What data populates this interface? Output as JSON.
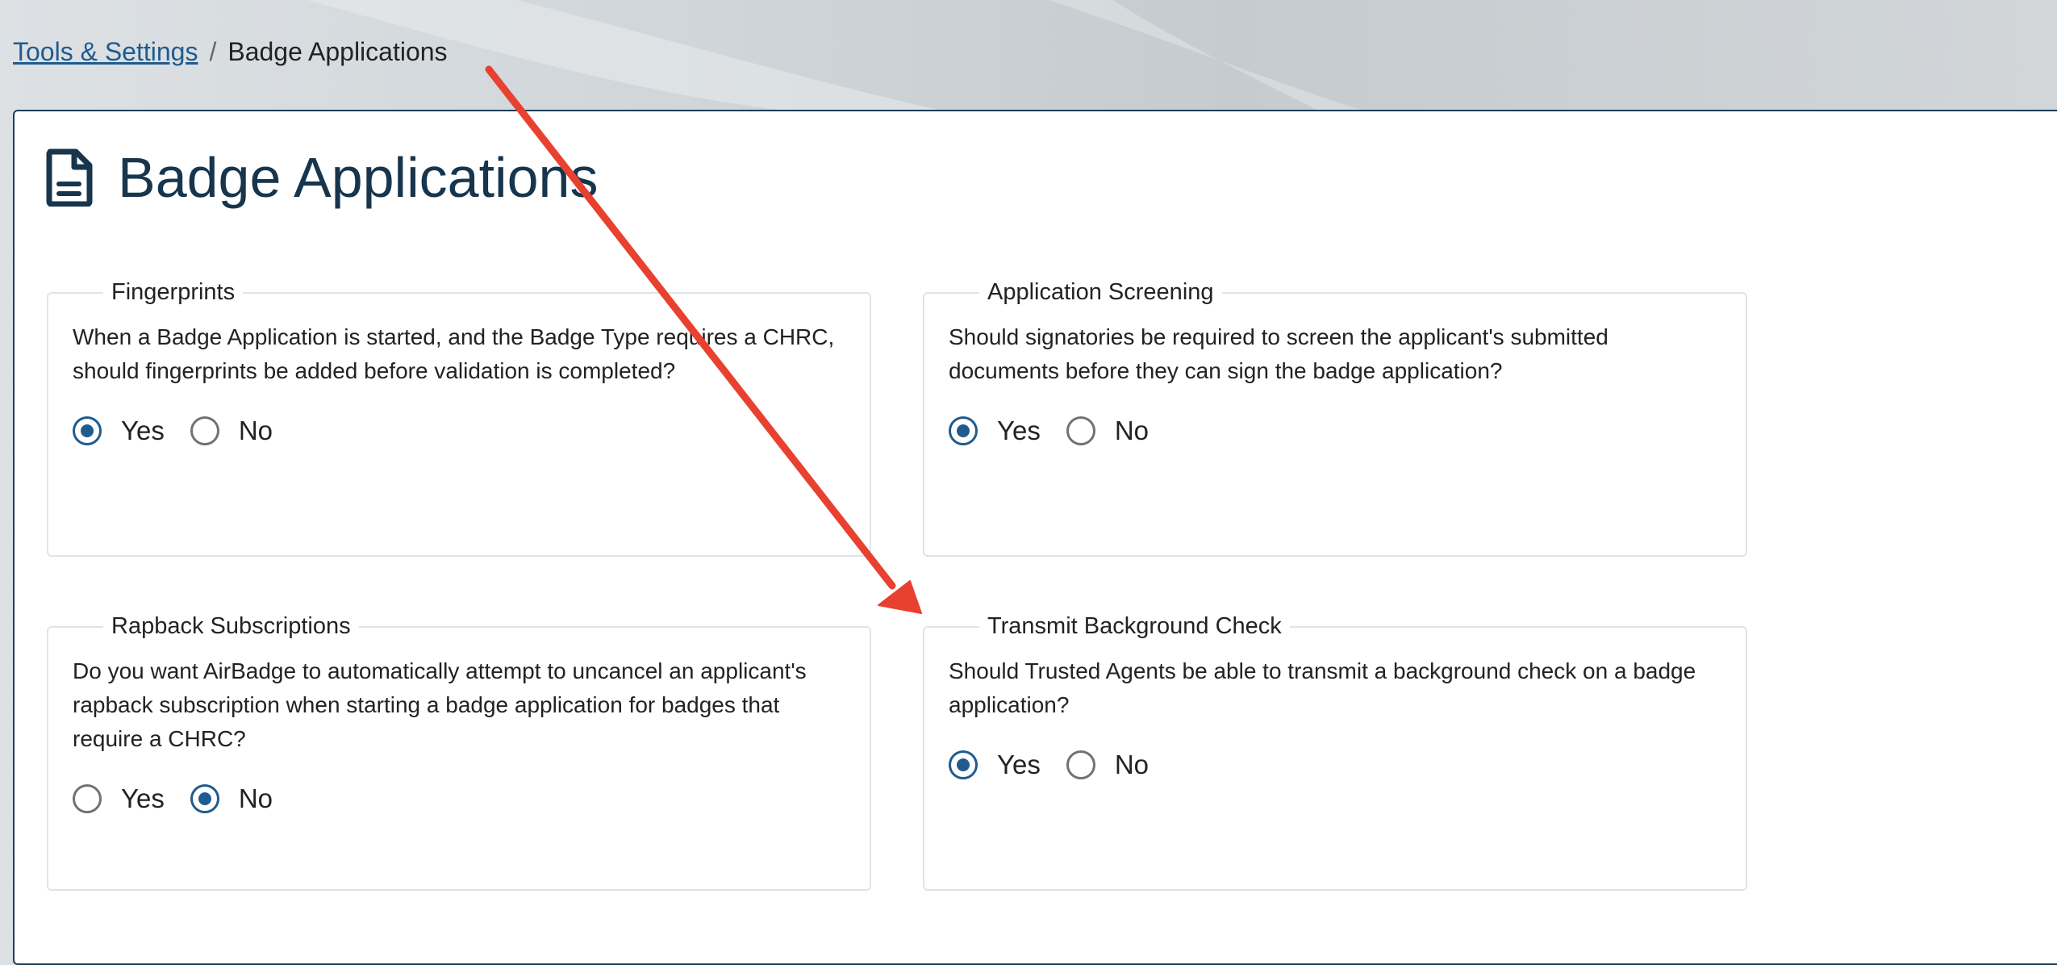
{
  "breadcrumb": {
    "parent": "Tools & Settings",
    "separator": "/",
    "current": "Badge Applications"
  },
  "page": {
    "title": "Badge Applications",
    "icon": "document-icon"
  },
  "colors": {
    "accent": "#1f5b8e",
    "title": "#17354d",
    "annotation_arrow": "#e8412f"
  },
  "cards": [
    {
      "legend": "Fingerprints",
      "question": "When a Badge Application is started, and the Badge Type requires a CHRC, should fingerprints be added before validation is completed?",
      "options": [
        "Yes",
        "No"
      ],
      "selected": "Yes"
    },
    {
      "legend": "Application Screening",
      "question": "Should signatories be required to screen the applicant's submitted documents before they can sign the badge application?",
      "options": [
        "Yes",
        "No"
      ],
      "selected": "Yes"
    },
    {
      "legend": "Rapback Subscriptions",
      "question": "Do you want AirBadge to automatically attempt to uncancel an applicant's rapback subscription when starting a badge application for badges that require a CHRC?",
      "options": [
        "Yes",
        "No"
      ],
      "selected": "No"
    },
    {
      "legend": "Transmit Background Check",
      "question": "Should Trusted Agents be able to transmit a background check on a badge application?",
      "options": [
        "Yes",
        "No"
      ],
      "selected": "Yes"
    }
  ]
}
